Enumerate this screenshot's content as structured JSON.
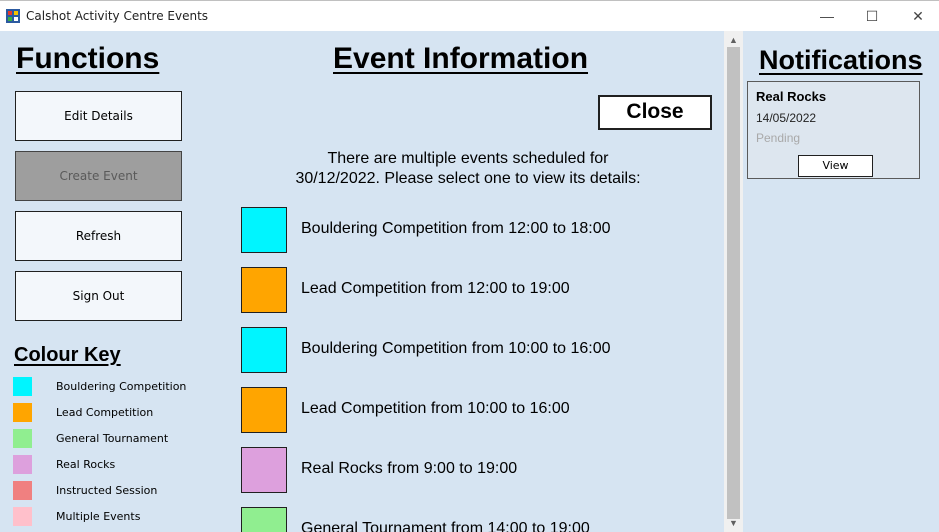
{
  "window": {
    "title": "Calshot Activity Centre Events",
    "minimize_glyph": "—",
    "maximize_glyph": "☐",
    "close_glyph": "✕"
  },
  "functions": {
    "heading": "Functions",
    "buttons": [
      {
        "label": "Edit Details",
        "enabled": true
      },
      {
        "label": "Create Event",
        "enabled": false
      },
      {
        "label": "Refresh",
        "enabled": true
      },
      {
        "label": "Sign Out",
        "enabled": true
      }
    ]
  },
  "colour_key": {
    "heading": "Colour Key",
    "items": [
      {
        "label": "Bouldering Competition",
        "color": "#00f5ff"
      },
      {
        "label": "Lead Competition",
        "color": "#ffa500"
      },
      {
        "label": "General Tournament",
        "color": "#90ee90"
      },
      {
        "label": "Real Rocks",
        "color": "#dda0dd"
      },
      {
        "label": "Instructed Session",
        "color": "#f08080"
      },
      {
        "label": "Multiple Events",
        "color": "#ffc0cb"
      }
    ]
  },
  "event_info": {
    "heading": "Event Information",
    "close_label": "Close",
    "intro": "There are multiple events scheduled for 30/12/2022. Please select one to view its details:",
    "events": [
      {
        "label": "Bouldering Competition from 12:00 to 18:00",
        "color": "#00f5ff"
      },
      {
        "label": "Lead Competition from 12:00 to 19:00",
        "color": "#ffa500"
      },
      {
        "label": "Bouldering Competition from 10:00 to 16:00",
        "color": "#00f5ff"
      },
      {
        "label": "Lead Competition from 10:00 to 16:00",
        "color": "#ffa500"
      },
      {
        "label": "Real Rocks from 9:00 to 19:00",
        "color": "#dda0dd"
      },
      {
        "label": "General Tournament from 14:00 to 19:00",
        "color": "#90ee90"
      }
    ]
  },
  "scrollbar": {
    "up_glyph": "▲",
    "down_glyph": "▼"
  },
  "notifications": {
    "heading": "Notifications",
    "items": [
      {
        "title": "Real Rocks",
        "date": "14/05/2022",
        "status": "Pending",
        "view_label": "View"
      }
    ]
  }
}
